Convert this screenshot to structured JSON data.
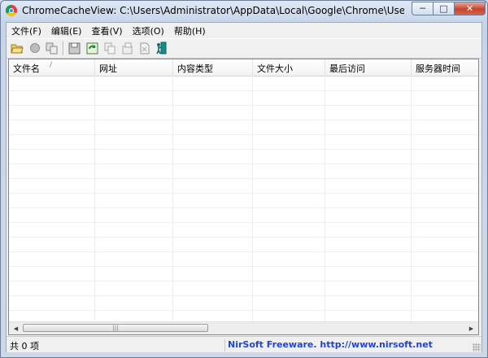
{
  "window": {
    "title": "ChromeCacheView:  C:\\Users\\Administrator\\AppData\\Local\\Google\\Chrome\\User Data\\De..."
  },
  "menu": [
    {
      "label": "文件(F)"
    },
    {
      "label": "编辑(E)"
    },
    {
      "label": "查看(V)"
    },
    {
      "label": "选项(O)"
    },
    {
      "label": "帮助(H)"
    }
  ],
  "toolbar": {
    "icons": [
      "open-folder-icon",
      "stop-icon",
      "copy-files-icon",
      "save-icon",
      "refresh-icon",
      "copy-icon",
      "properties-icon",
      "html-report-icon",
      "exit-icon"
    ]
  },
  "table": {
    "columns": [
      {
        "label": "文件名"
      },
      {
        "label": "网址"
      },
      {
        "label": "内容类型"
      },
      {
        "label": "文件大小"
      },
      {
        "label": "最后访问"
      },
      {
        "label": "服务器时间"
      }
    ],
    "sort_indicator": "/",
    "rows": []
  },
  "status": {
    "count_text": "共 0 项",
    "link_text": "NirSoft Freeware.  http://www.nirsoft.net",
    "link_color": "#2244cc"
  },
  "scrollbar": {
    "left_arrow": "◀",
    "right_arrow": "▶",
    "thumb_grip": "|||"
  },
  "window_buttons": {
    "minimize": "─",
    "maximize": "□",
    "close": "✕"
  }
}
